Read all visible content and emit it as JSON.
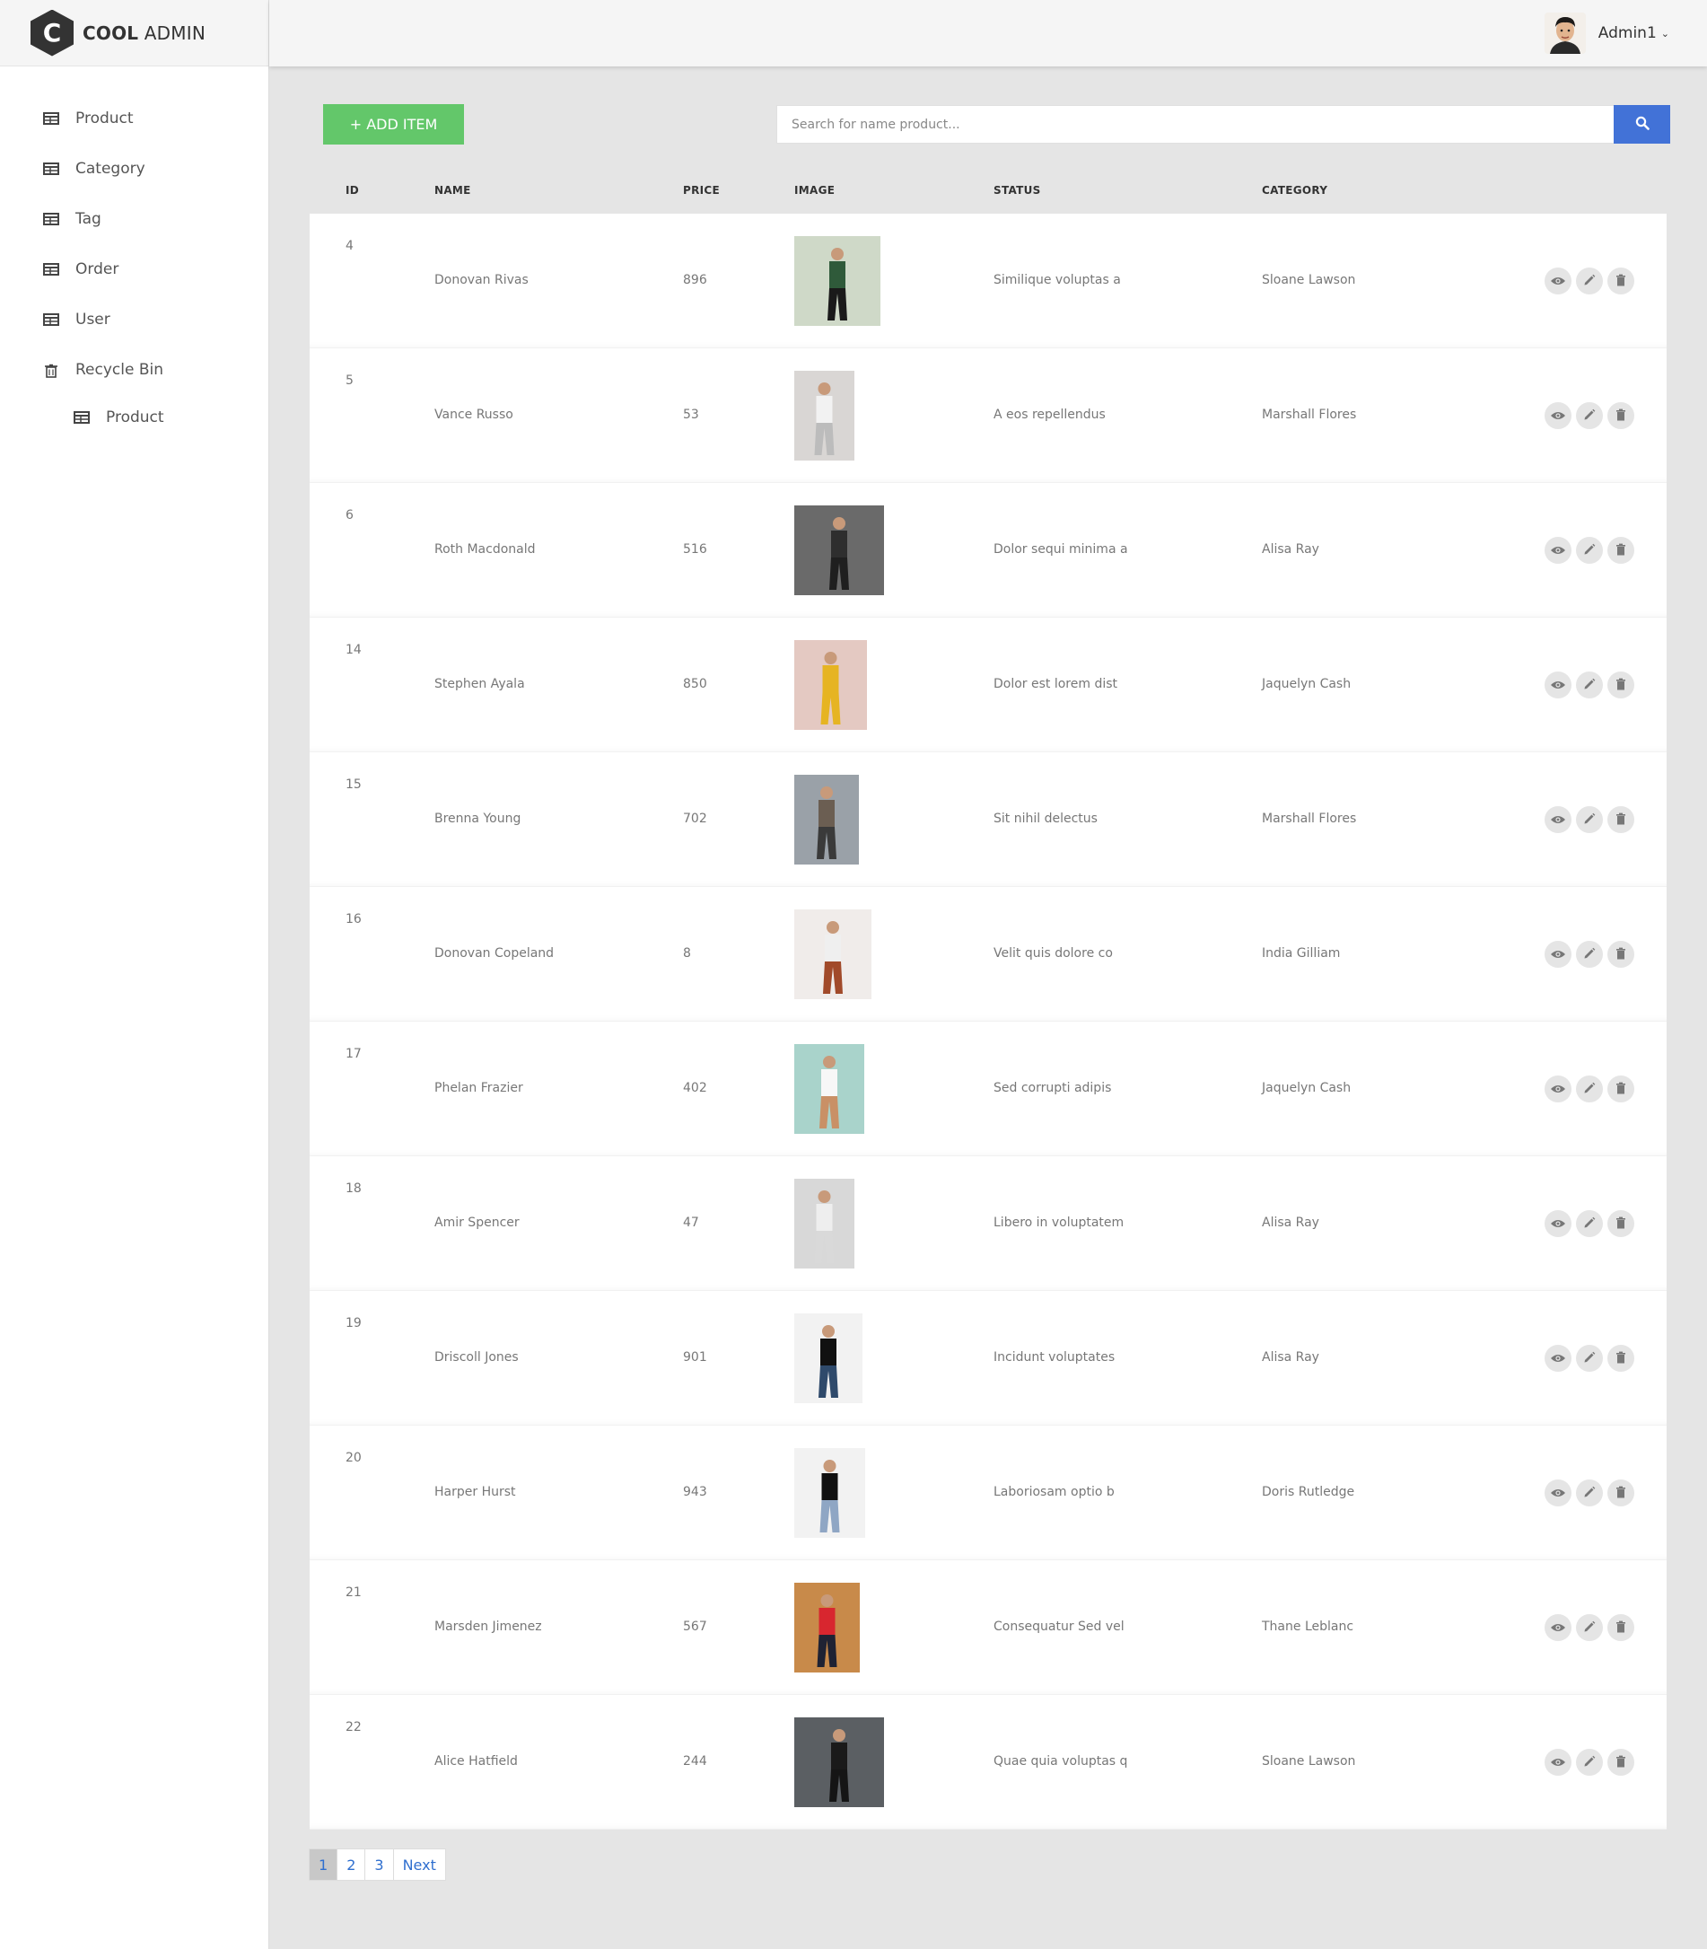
{
  "brand": {
    "logo_letter": "C",
    "name_bold": "COOL",
    "name_light": " ADMIN"
  },
  "sidebar": {
    "items": [
      {
        "label": "Product",
        "icon": "table-icon"
      },
      {
        "label": "Category",
        "icon": "table-icon"
      },
      {
        "label": "Tag",
        "icon": "table-icon"
      },
      {
        "label": "Order",
        "icon": "table-icon"
      },
      {
        "label": "User",
        "icon": "table-icon"
      },
      {
        "label": "Recycle Bin",
        "icon": "trash-icon"
      }
    ],
    "sub_items": [
      {
        "label": "Product",
        "icon": "table-icon"
      }
    ]
  },
  "header": {
    "account_name": "Admin1",
    "chevron": "⌄"
  },
  "toolbar": {
    "add_label": "+ ADD ITEM",
    "search_placeholder": "Search for name product...",
    "add_color": "#63c76a",
    "search_color": "#4272d7"
  },
  "table": {
    "columns": [
      "ID",
      "NAME",
      "PRICE",
      "IMAGE",
      "STATUS",
      "CATEGORY"
    ],
    "rows": [
      {
        "id": "4",
        "name": "Donovan Rivas",
        "price": "896",
        "status": "Similique voluptas a",
        "category": "Sloane Lawson"
      },
      {
        "id": "5",
        "name": "Vance Russo",
        "price": "53",
        "status": "A eos repellendus",
        "category": "Marshall Flores"
      },
      {
        "id": "6",
        "name": "Roth Macdonald",
        "price": "516",
        "status": "Dolor sequi minima a",
        "category": "Alisa Ray"
      },
      {
        "id": "14",
        "name": "Stephen Ayala",
        "price": "850",
        "status": "Dolor est lorem dist",
        "category": "Jaquelyn Cash"
      },
      {
        "id": "15",
        "name": "Brenna Young",
        "price": "702",
        "status": "Sit nihil delectus",
        "category": "Marshall Flores"
      },
      {
        "id": "16",
        "name": "Donovan Copeland",
        "price": "8",
        "status": "Velit quis dolore co",
        "category": "India Gilliam"
      },
      {
        "id": "17",
        "name": "Phelan Frazier",
        "price": "402",
        "status": "Sed corrupti adipis",
        "category": "Jaquelyn Cash"
      },
      {
        "id": "18",
        "name": "Amir Spencer",
        "price": "47",
        "status": "Libero in voluptatem",
        "category": "Alisa Ray"
      },
      {
        "id": "19",
        "name": "Driscoll Jones",
        "price": "901",
        "status": "Incidunt voluptates",
        "category": "Alisa Ray"
      },
      {
        "id": "20",
        "name": "Harper Hurst",
        "price": "943",
        "status": "Laboriosam optio b",
        "category": "Doris Rutledge"
      },
      {
        "id": "21",
        "name": "Marsden Jimenez",
        "price": "567",
        "status": "Consequatur Sed vel",
        "category": "Thane Leblanc"
      },
      {
        "id": "22",
        "name": "Alice Hatfield",
        "price": "244",
        "status": "Quae quia voluptas q",
        "category": "Sloane Lawson"
      }
    ]
  },
  "pagination": {
    "pages": [
      "1",
      "2",
      "3"
    ],
    "next_label": "Next",
    "active": "1"
  }
}
